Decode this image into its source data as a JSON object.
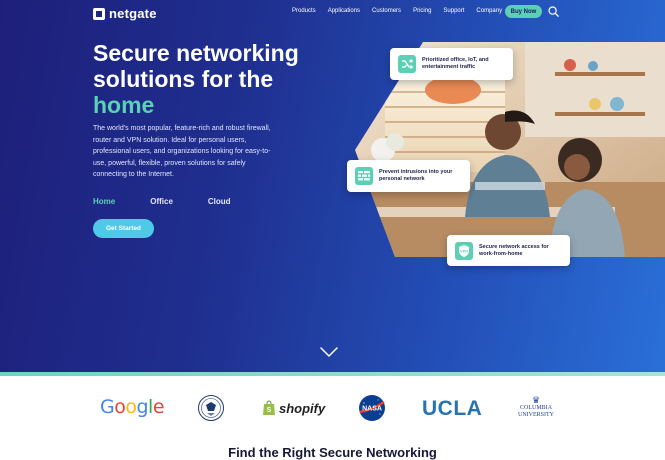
{
  "brand": {
    "name": "netgate"
  },
  "nav": {
    "items": [
      "Products",
      "Applications",
      "Customers",
      "Pricing",
      "Support",
      "Company"
    ],
    "cta_label": "Buy Now"
  },
  "hero": {
    "headline_line1": "Secure networking",
    "headline_line2": "solutions for the",
    "headline_accent": "home",
    "description": "The world's most popular, feature-rich and robust firewall, router and VPN solution. Ideal for personal users, professional users, and organizations looking for easy-to-use, powerful, flexible, proven solutions for safely connecting to the Internet.",
    "tabs": [
      {
        "label": "Home",
        "active": true
      },
      {
        "label": "Office",
        "active": false
      },
      {
        "label": "Cloud",
        "active": false
      }
    ],
    "cta_label": "Get Started"
  },
  "feature_cards": [
    {
      "text": "Prioritized office, IoT, and entertainment traffic",
      "icon": "shuffle-icon"
    },
    {
      "text": "Prevent intrusions into your personal network",
      "icon": "firewall-icon"
    },
    {
      "text": "Secure network access for work-from-home",
      "icon": "vpn-shield-icon"
    }
  ],
  "customer_logos": {
    "google": "Google",
    "shopify": "shopify",
    "ucla": "UCLA",
    "columbia": "COLUMBIA UNIVERSITY",
    "nasa": "NASA"
  },
  "next_section": {
    "title": "Find the Right Secure Networking"
  },
  "colors": {
    "accent": "#5bd0b5",
    "cta": "#4ec9e8",
    "hero_dark": "#1e1f7a",
    "hero_light": "#2a6fd8"
  }
}
